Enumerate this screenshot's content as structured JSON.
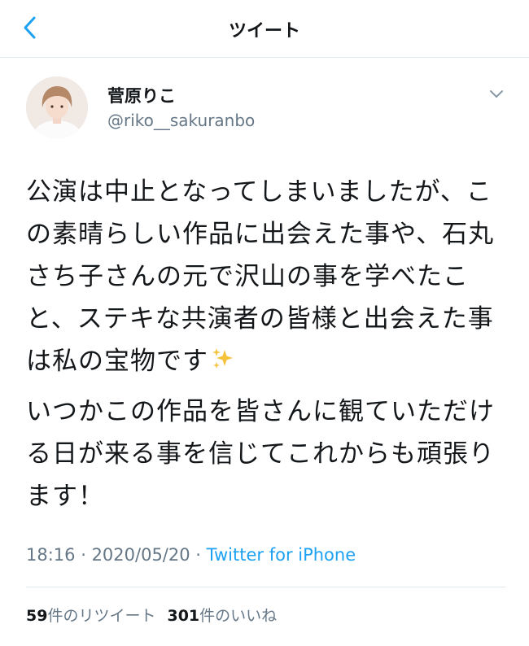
{
  "header": {
    "title": "ツイート",
    "back_icon": "chevron-left-icon"
  },
  "author": {
    "display_name": "菅原りこ",
    "handle": "@riko__sakuranbo",
    "menu_icon": "chevron-down-icon"
  },
  "tweet": {
    "paragraph_1": "公演は中止となってしまいましたが、この素晴らしい作品に出会えた事や、石丸さち子さんの元で沢山の事を学べたこと、ステキな共演者の皆様と出会えた事は私の宝物です",
    "paragraph_1_emoji": "sparkles-icon",
    "paragraph_2": "いつかこの作品を皆さんに観ていただける日が来る事を信じてこれからも頑張ります！"
  },
  "meta": {
    "time": "18:16",
    "separator_1": " · ",
    "date": "2020/05/20",
    "separator_2": " · ",
    "source": "Twitter for iPhone"
  },
  "stats": {
    "retweets_count": "59",
    "retweets_label": "件のリツイート",
    "likes_count": "301",
    "likes_label": "件のいいね"
  },
  "colors": {
    "accent": "#1da1f2",
    "secondary_text": "#657786",
    "primary_text": "#14171a",
    "divider": "#e1e8ed"
  }
}
